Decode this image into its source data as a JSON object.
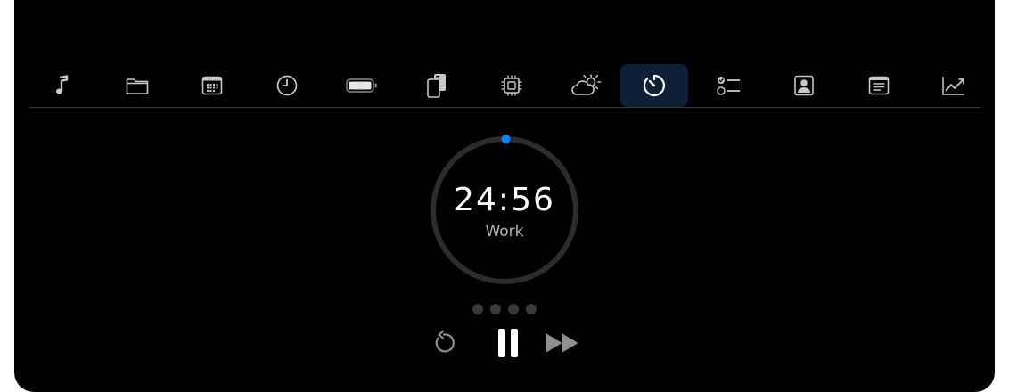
{
  "tabs": [
    {
      "name": "music",
      "icon": "music-note-icon"
    },
    {
      "name": "files",
      "icon": "folder-icon"
    },
    {
      "name": "calendar",
      "icon": "calendar-icon"
    },
    {
      "name": "clock",
      "icon": "clock-icon"
    },
    {
      "name": "battery",
      "icon": "battery-icon"
    },
    {
      "name": "devices",
      "icon": "devices-icon"
    },
    {
      "name": "cpu",
      "icon": "cpu-chip-icon"
    },
    {
      "name": "weather",
      "icon": "cloud-sun-icon"
    },
    {
      "name": "timer",
      "icon": "timer-icon",
      "active": true
    },
    {
      "name": "reminders",
      "icon": "checklist-icon"
    },
    {
      "name": "contacts",
      "icon": "contact-card-icon"
    },
    {
      "name": "notes",
      "icon": "notes-icon"
    },
    {
      "name": "stocks",
      "icon": "chart-line-icon"
    }
  ],
  "timer": {
    "time": "24:56",
    "mode": "Work",
    "progress": 0.003,
    "sessions_total": 4,
    "sessions_completed": 0
  },
  "controls": {
    "restart_icon": "restart-icon",
    "pause_icon": "pause-icon",
    "skip_icon": "skip-forward-icon"
  },
  "colors": {
    "background": "#000000",
    "accent": "#0a84ff",
    "active_tab": "#0d2038",
    "ring_track": "#2c2c2e",
    "icon_gray": "#c7c7cc",
    "dot_inactive": "#3a3a3c"
  }
}
